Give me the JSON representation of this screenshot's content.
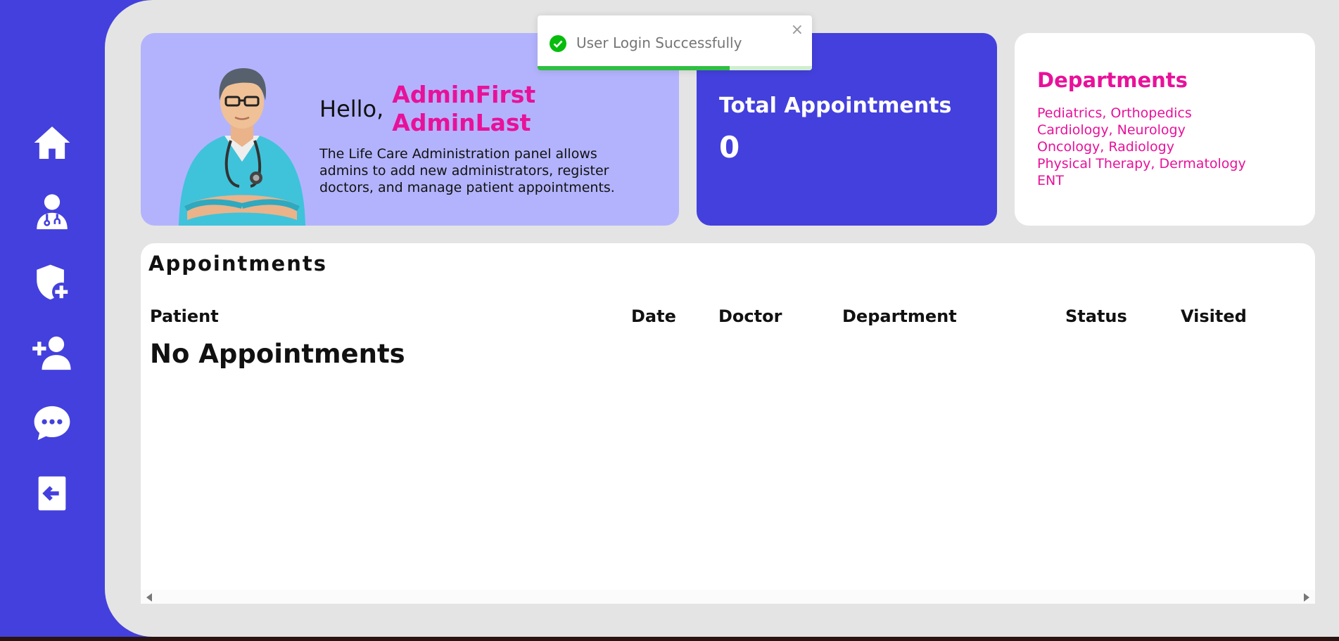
{
  "sidebar": {
    "items": [
      {
        "name": "home-icon"
      },
      {
        "name": "doctor-icon"
      },
      {
        "name": "shield-plus-icon"
      },
      {
        "name": "add-user-icon"
      },
      {
        "name": "message-icon"
      },
      {
        "name": "logout-icon"
      }
    ]
  },
  "welcome": {
    "greeting": "Hello,",
    "first_name": "AdminFirst",
    "last_name": "AdminLast",
    "description": "The Life Care Administration panel allows admins to add new administrators, register doctors, and manage patient appointments."
  },
  "total_appointments": {
    "title": "Total Appointments",
    "count": "0"
  },
  "departments": {
    "title": "Departments",
    "lines": [
      "Pediatrics, Orthopedics",
      "Cardiology, Neurology",
      "Oncology, Radiology",
      "Physical Therapy, Dermatology",
      "ENT"
    ]
  },
  "appointments": {
    "title": "Appointments",
    "columns": [
      "Patient",
      "Date",
      "Doctor",
      "Department",
      "Status",
      "Visited"
    ],
    "empty_message": "No Appointments"
  },
  "toast": {
    "message": "User Login Successfully",
    "close": "×",
    "progress": 0.7
  },
  "colors": {
    "accent": "#4440dd",
    "pink": "#e8119a",
    "welcome_bg": "#b3b3fd",
    "success": "#2fbf41"
  }
}
